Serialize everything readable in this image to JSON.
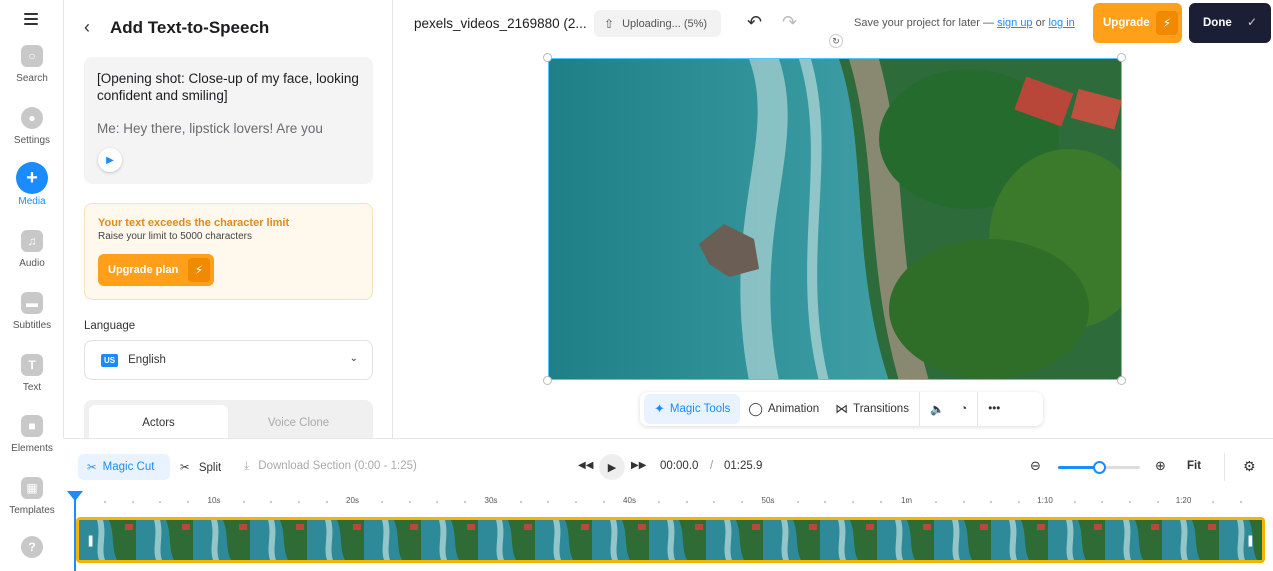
{
  "rail": {
    "items": [
      {
        "label": "Search",
        "icon": "search-icon"
      },
      {
        "label": "Settings",
        "icon": "gear-icon"
      },
      {
        "label": "Media",
        "icon": "plus-icon",
        "active": true
      },
      {
        "label": "Audio",
        "icon": "music-icon"
      },
      {
        "label": "Subtitles",
        "icon": "subtitles-icon"
      },
      {
        "label": "Text",
        "icon": "text-icon"
      },
      {
        "label": "Elements",
        "icon": "elements-icon"
      },
      {
        "label": "Templates",
        "icon": "templates-icon"
      }
    ],
    "help_glyph": "?"
  },
  "panel": {
    "title": "Add Text-to-Speech",
    "script_line1": "[Opening shot: Close-up of my face, looking confident and smiling]",
    "script_line2": "Me: Hey there, lipstick lovers! Are you",
    "limit_title": "Your text exceeds the character limit",
    "limit_sub": "Raise your limit to 5000 characters",
    "upgrade_plan_label": "Upgrade plan",
    "language_label": "Language",
    "language_flag": "US",
    "language_value": "English",
    "tabs": [
      "Actors",
      "Voice Clone"
    ]
  },
  "topbar": {
    "file_name": "pexels_videos_2169880 (2...",
    "uploading": "Uploading... (5%)",
    "save_prefix": "Save your project for later —",
    "sign_up": "sign up",
    "or": "or",
    "log_in": "log in",
    "upgrade_label": "Upgrade",
    "done_label": "Done"
  },
  "toolbar": {
    "magic_tools": "Magic Tools",
    "animation": "Animation",
    "transitions": "Transitions",
    "more": "•••"
  },
  "timeline": {
    "magic_cut": "Magic Cut",
    "split": "Split",
    "download_section": "Download Section (0:00 - 1:25)",
    "current_time": "00:00.0",
    "time_separator": "/",
    "total_time": "01:25.9",
    "fit": "Fit",
    "zoom_level": 0.5,
    "ruler_labels": [
      "10s",
      "20s",
      "30s",
      "40s",
      "50s",
      "1m",
      "1:10",
      "1:20"
    ]
  },
  "colors": {
    "accent": "#1a8cff",
    "upgrade": "#ff9f1a",
    "done": "#1a1f36",
    "track_border": "#f5b400"
  }
}
